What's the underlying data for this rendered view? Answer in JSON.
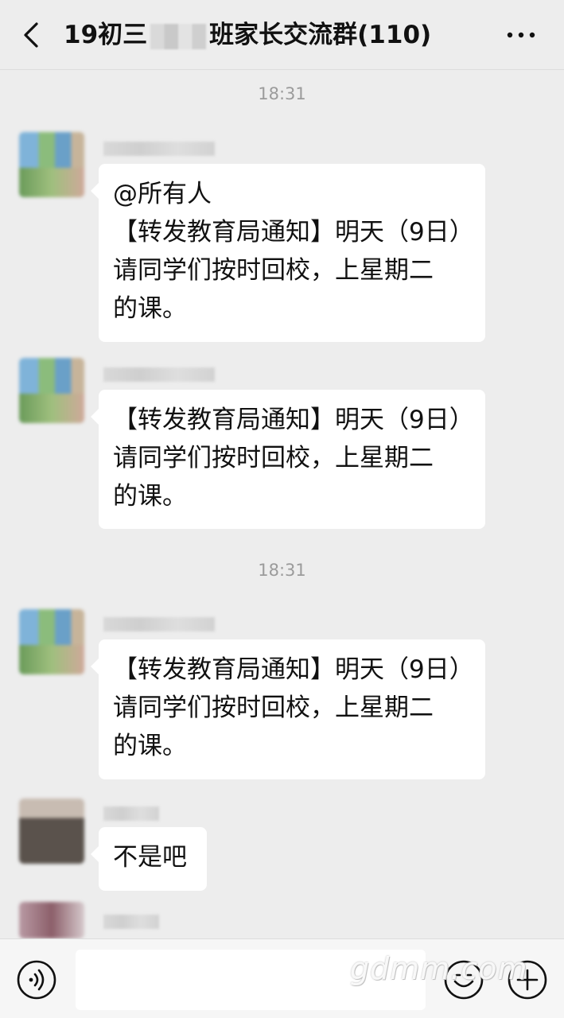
{
  "header": {
    "title_prefix": "19初三",
    "title_suffix": "班家长交流群(110)"
  },
  "timestamps": [
    "18:31",
    "18:31"
  ],
  "messages": [
    {
      "lines": [
        "@所有人",
        "【转发教育局通知】明天（9日）",
        "请同学们按时回校，上星期二",
        "的课。"
      ]
    },
    {
      "lines": [
        "【转发教育局通知】明天（9日）",
        "请同学们按时回校，上星期二",
        "的课。"
      ]
    },
    {
      "lines": [
        "【转发教育局通知】明天（9日）",
        "请同学们按时回校，上星期二",
        "的课。"
      ]
    },
    {
      "lines": [
        "不是吧"
      ]
    }
  ],
  "input": {
    "placeholder": ""
  },
  "watermark": "gdmm.com",
  "icons": [
    "back-icon",
    "more-icon",
    "voice-icon",
    "emoji-icon",
    "plus-icon"
  ],
  "colors": {
    "background": "#ededed",
    "bubble": "#ffffff",
    "timestamp": "#9b9b9b"
  }
}
